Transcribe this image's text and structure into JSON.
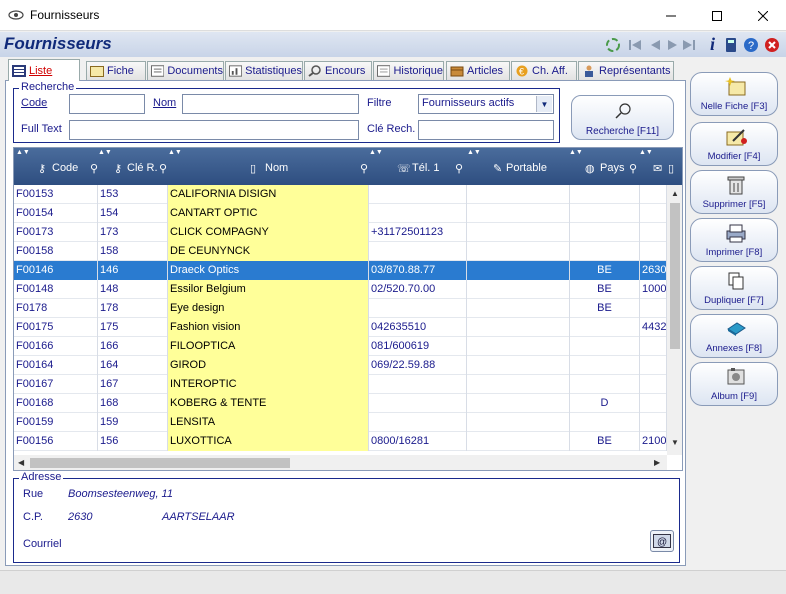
{
  "window": {
    "title": "Fournisseurs",
    "minimize": "—",
    "maximize": "☐",
    "close": "✕"
  },
  "header": {
    "title": "Fournisseurs",
    "info": "i"
  },
  "tabs": [
    {
      "label": "Liste",
      "active": true
    },
    {
      "label": "Fiche"
    },
    {
      "label": "Documents"
    },
    {
      "label": "Statistiques"
    },
    {
      "label": "Encours"
    },
    {
      "label": "Historique"
    },
    {
      "label": "Articles"
    },
    {
      "label": "Ch. Aff."
    },
    {
      "label": "Représentants"
    }
  ],
  "search": {
    "group_label": "Recherche",
    "code_label": "Code",
    "code_value": "",
    "nom_label": "Nom",
    "nom_value": "",
    "filtre_label": "Filtre",
    "filtre_value": "Fournisseurs actifs",
    "fulltext_label": "Full Text",
    "fulltext_value": "",
    "clerech_label": "Clé Rech.",
    "clerech_value": "",
    "button_label": "Recherche [F11]"
  },
  "grid": {
    "columns": [
      "Code",
      "Clé R.",
      "Nom",
      "Tél. 1",
      "Portable",
      "Pays"
    ],
    "rows": [
      {
        "code": "F00153",
        "cle": "153",
        "nom": "CALIFORNIA DISIGN",
        "tel": "",
        "port": "",
        "pays": "",
        "extra": ""
      },
      {
        "code": "F00154",
        "cle": "154",
        "nom": "CANTART OPTIC",
        "tel": "",
        "port": "",
        "pays": "",
        "extra": ""
      },
      {
        "code": "F00173",
        "cle": "173",
        "nom": "CLICK COMPAGNY",
        "tel": "+31172501123",
        "port": "",
        "pays": "",
        "extra": ""
      },
      {
        "code": "F00158",
        "cle": "158",
        "nom": "DE CEUNYNCK",
        "tel": "",
        "port": "",
        "pays": "",
        "extra": ""
      },
      {
        "code": "F00146",
        "cle": "146",
        "nom": "Draeck Optics",
        "tel": "03/870.88.77",
        "port": "",
        "pays": "BE",
        "extra": "2630",
        "selected": true
      },
      {
        "code": "F00148",
        "cle": "148",
        "nom": "Essilor Belgium",
        "tel": "02/520.70.00",
        "port": "",
        "pays": "BE",
        "extra": "1000"
      },
      {
        "code": "F0178",
        "cle": "178",
        "nom": "Eye design",
        "tel": "",
        "port": "",
        "pays": "BE",
        "extra": ""
      },
      {
        "code": "F00175",
        "cle": "175",
        "nom": "Fashion vision",
        "tel": "042635510",
        "port": "",
        "pays": "",
        "extra": "4432"
      },
      {
        "code": "F00166",
        "cle": "166",
        "nom": "FILOOPTICA",
        "tel": "081/600619",
        "port": "",
        "pays": "",
        "extra": ""
      },
      {
        "code": "F00164",
        "cle": "164",
        "nom": "GIROD",
        "tel": "069/22.59.88",
        "port": "",
        "pays": "",
        "extra": ""
      },
      {
        "code": "F00167",
        "cle": "167",
        "nom": "INTEROPTIC",
        "tel": "",
        "port": "",
        "pays": "",
        "extra": ""
      },
      {
        "code": "F00168",
        "cle": "168",
        "nom": "KOBERG & TENTE",
        "tel": "",
        "port": "",
        "pays": "D",
        "extra": ""
      },
      {
        "code": "F00159",
        "cle": "159",
        "nom": "LENSITA",
        "tel": "",
        "port": "",
        "pays": "",
        "extra": ""
      },
      {
        "code": "F00156",
        "cle": "156",
        "nom": "LUXOTTICA",
        "tel": "0800/16281",
        "port": "",
        "pays": "BE",
        "extra": "2100"
      }
    ]
  },
  "address": {
    "group_label": "Adresse",
    "rue_label": "Rue",
    "rue_value": "Boomsesteenweg, 11",
    "cp_label": "C.P.",
    "cp_value": "2630",
    "city_value": "AARTSELAAR",
    "courriel_label": "Courriel",
    "courriel_value": ""
  },
  "sidebar": [
    {
      "label": "Nelle Fiche [F3]",
      "icon": "new-file-icon"
    },
    {
      "label": "Modifier [F4]",
      "icon": "edit-icon"
    },
    {
      "label": "Supprimer [F5]",
      "icon": "trash-icon"
    },
    {
      "label": "Imprimer [F8]",
      "icon": "printer-icon"
    },
    {
      "label": "Dupliquer [F7]",
      "icon": "duplicate-icon"
    },
    {
      "label": "Annexes [F8]",
      "icon": "attachment-icon"
    },
    {
      "label": "Album [F9]",
      "icon": "album-icon"
    }
  ],
  "colors": {
    "accent": "#102a7a",
    "selection": "#2a7bd0",
    "name_column": "#ffff99",
    "active_tab_text": "#d00000"
  }
}
